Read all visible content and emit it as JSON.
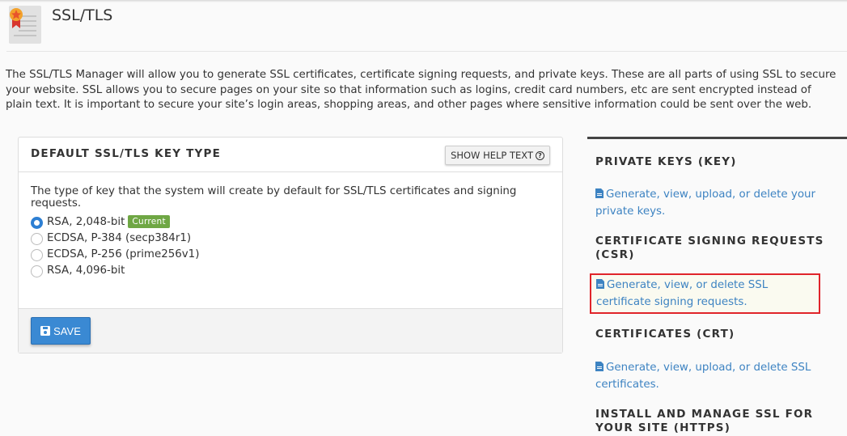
{
  "header": {
    "title": "SSL/TLS",
    "icon": "certificate-icon"
  },
  "intro": "The SSL/TLS Manager will allow you to generate SSL certificates, certificate signing requests, and private keys. These are all parts of using SSL to secure your website. SSL allows you to secure pages on your site so that information such as logins, credit card numbers, etc are sent encrypted instead of plain text. It is important to secure your site’s login areas, shopping areas, and other pages where sensitive information could be sent over the web.",
  "key_type_panel": {
    "title": "DEFAULT SSL/TLS KEY TYPE",
    "help_button": "SHOW HELP TEXT",
    "description": "The type of key that the system will create by default for SSL/TLS certificates and signing requests.",
    "options": [
      {
        "label": "RSA, 2,048-bit",
        "checked": true,
        "badge": "Current"
      },
      {
        "label": "ECDSA, P-384 (secp384r1)",
        "checked": false
      },
      {
        "label": "ECDSA, P-256 (prime256v1)",
        "checked": false
      },
      {
        "label": "RSA, 4,096-bit",
        "checked": false
      }
    ],
    "save_label": "SAVE"
  },
  "sidebar": {
    "sections": [
      {
        "heading": "PRIVATE KEYS (KEY)",
        "link": "Generate, view, upload, or delete your private keys."
      },
      {
        "heading": "CERTIFICATE SIGNING REQUESTS (CSR)",
        "link": "Generate, view, or delete SSL certificate signing requests.",
        "highlighted": true
      },
      {
        "heading": "CERTIFICATES (CRT)",
        "link": "Generate, view, upload, or delete SSL certificates."
      },
      {
        "heading": "INSTALL AND MANAGE SSL FOR YOUR SITE (HTTPS)"
      }
    ]
  },
  "colors": {
    "accent": "#3a89d3",
    "link": "#3d83c2",
    "badge": "#6fa744",
    "highlight_border": "#e0242a"
  }
}
